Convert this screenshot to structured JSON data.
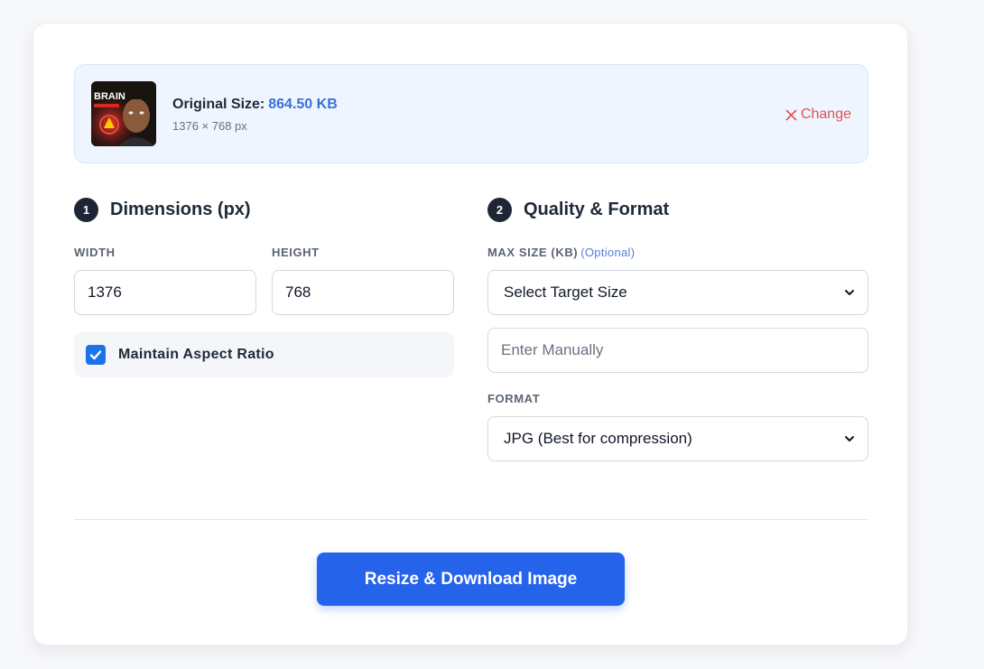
{
  "file": {
    "original_size_label": "Original Size:",
    "original_size_value": "864.50 KB",
    "dimensions_text": "1376 × 768 px",
    "thumbnail_text": "BRAIN",
    "change_label": "Change",
    "change_icon": "close-icon"
  },
  "dimensions": {
    "step": "1",
    "title": "Dimensions (px)",
    "width_label": "WIDTH",
    "width_value": "1376",
    "height_label": "HEIGHT",
    "height_value": "768",
    "aspect_label": "Maintain Aspect Ratio",
    "aspect_checked": true
  },
  "quality": {
    "step": "2",
    "title": "Quality & Format",
    "max_size_label": "MAX SIZE (KB)",
    "max_size_optional": "(Optional)",
    "target_size_selected": "Select Target Size",
    "manual_placeholder": "Enter Manually",
    "format_label": "FORMAT",
    "format_selected": "JPG (Best for compression)"
  },
  "actions": {
    "submit_label": "Resize & Download Image"
  },
  "colors": {
    "accent": "#2563eb",
    "size_value": "#3b6fd8",
    "change": "#e05252",
    "banner_bg": "#eef5ff"
  }
}
